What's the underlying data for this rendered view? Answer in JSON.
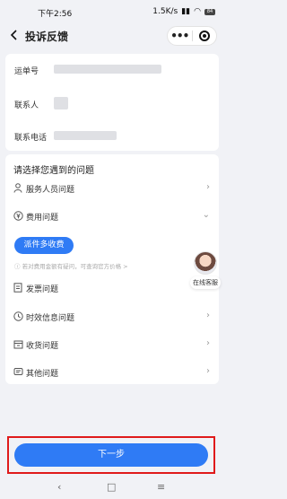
{
  "status_bar": {
    "time": "下午2:56",
    "indicators": "1.5K/s",
    "battery": "84"
  },
  "nav": {
    "title": "投诉反馈",
    "more": "•••"
  },
  "order": {
    "waybill_label": "运单号",
    "contact_label": "联系人",
    "phone_label": "联系电话"
  },
  "problems": {
    "section_title": "请选择您遇到的问题",
    "items": [
      {
        "label": "服务人员问题",
        "icon": "person-icon"
      },
      {
        "label": "费用问题",
        "icon": "yen-icon"
      },
      {
        "label": "发票问题",
        "icon": "invoice-icon"
      },
      {
        "label": "时效信息问题",
        "icon": "clock-icon"
      },
      {
        "label": "收货问题",
        "icon": "box-icon"
      },
      {
        "label": "其他问题",
        "icon": "message-icon"
      }
    ],
    "fee_option": "派件多收费",
    "fee_hint": "若对费用金额有疑问，可查询官方价格 >"
  },
  "service": {
    "label": "在线客服"
  },
  "footer": {
    "next_label": "下一步"
  },
  "colors": {
    "primary": "#2f7bf5",
    "highlight": "#e01a1a"
  }
}
